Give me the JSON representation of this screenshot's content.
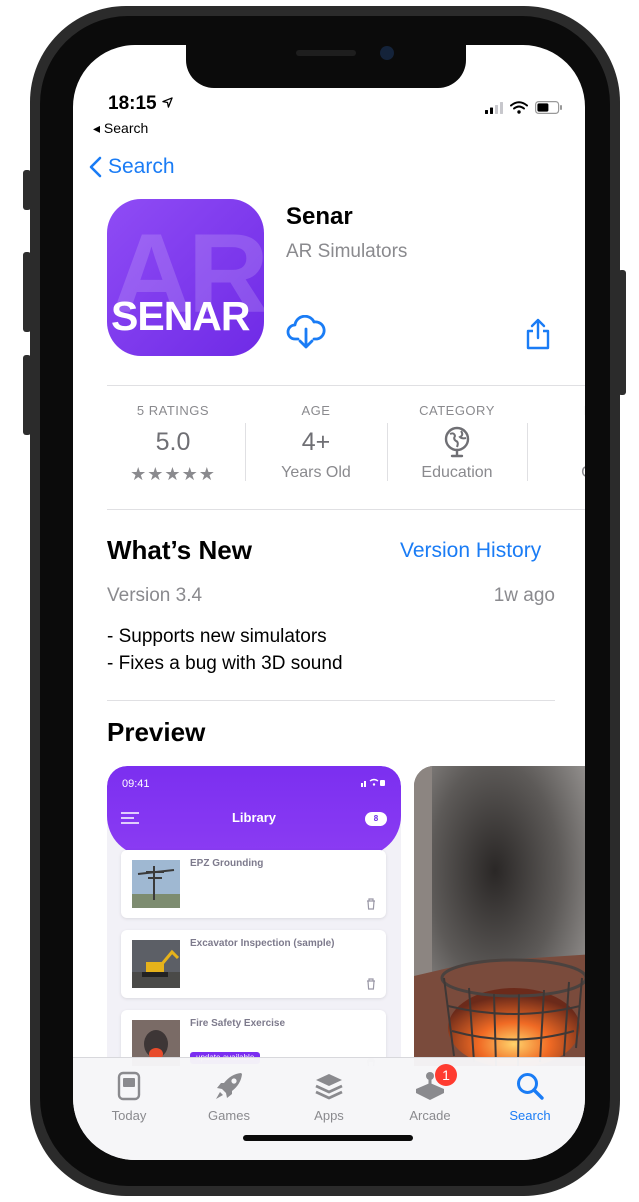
{
  "status_bar": {
    "time": "18:15",
    "back_label": "◂ Search"
  },
  "nav": {
    "back_label": "Search"
  },
  "app": {
    "name": "Senar",
    "developer": "AR Simulators",
    "icon_text_big": "AR",
    "icon_text": "SENAR"
  },
  "stats": [
    {
      "label": "5 RATINGS",
      "value": "5.0",
      "sub": "★★★★★"
    },
    {
      "label": "AGE",
      "value": "4+",
      "sub": "Years Old"
    },
    {
      "label": "CATEGORY",
      "value": "",
      "sub": "Education"
    },
    {
      "label": "DEV",
      "value": "",
      "sub": "Guid"
    }
  ],
  "whats_new": {
    "title": "What’s New",
    "link": "Version History",
    "version": "Version 3.4",
    "ago": "1w ago",
    "notes": [
      "- Supports new simulators",
      "- Fixes a bug with 3D sound"
    ]
  },
  "preview": {
    "title": "Preview",
    "shot1": {
      "time": "09:41",
      "title": "Library",
      "badge": "8",
      "items": [
        {
          "title": "EPZ Grounding"
        },
        {
          "title": "Excavator Inspection (sample)"
        },
        {
          "title": "Fire Safety Exercise",
          "tag": "update available"
        }
      ]
    }
  },
  "tabbar": {
    "items": [
      {
        "label": "Today",
        "icon": "today-icon"
      },
      {
        "label": "Games",
        "icon": "rocket-icon"
      },
      {
        "label": "Apps",
        "icon": "layers-icon"
      },
      {
        "label": "Arcade",
        "icon": "joystick-icon",
        "badge": "1"
      },
      {
        "label": "Search",
        "icon": "search-icon",
        "active": true
      }
    ]
  },
  "colors": {
    "accent": "#1a7cf5",
    "icon_purple": "#7b2ff0",
    "badge_red": "#ff3b30",
    "frame": "#2b2b2b"
  }
}
